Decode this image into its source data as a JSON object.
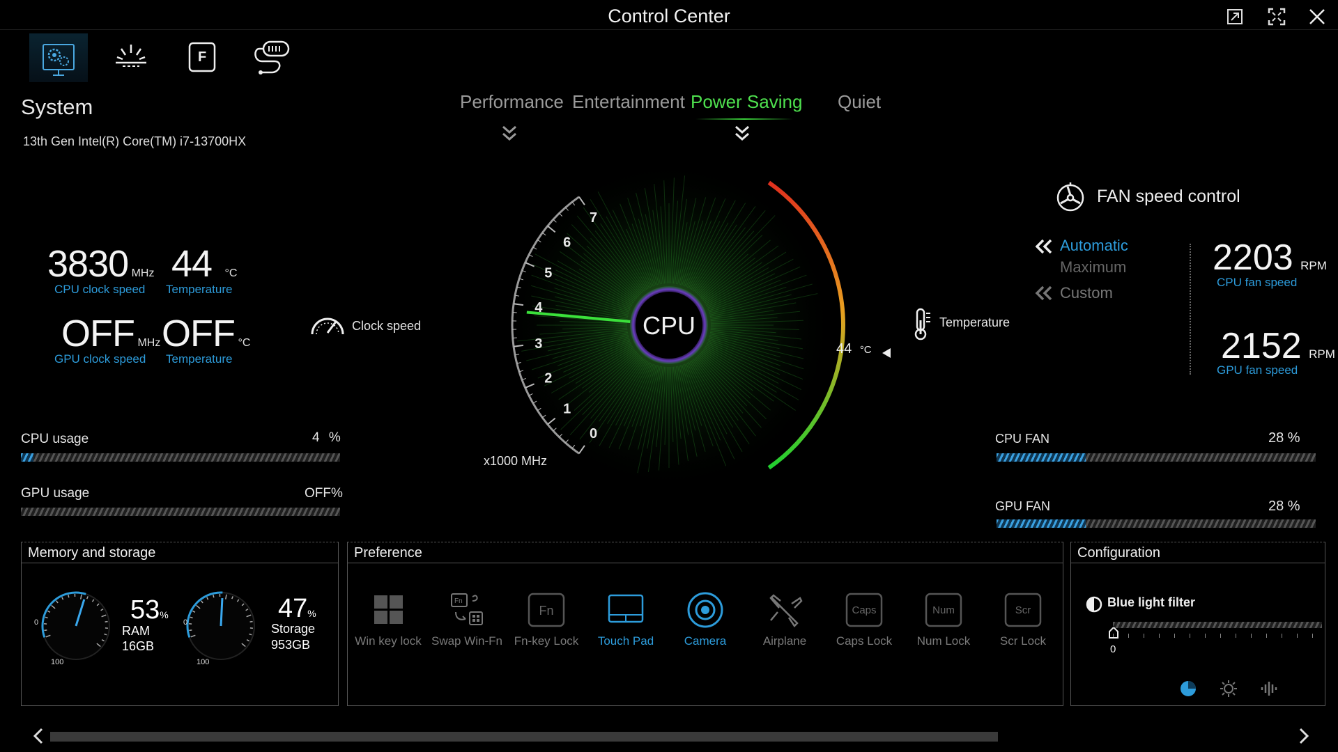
{
  "window": {
    "title": "Control Center"
  },
  "nav_tabs": [
    {
      "icon": "system-settings-icon",
      "active": true
    },
    {
      "icon": "lighting-icon",
      "active": false
    },
    {
      "icon": "function-key-icon",
      "active": false
    },
    {
      "icon": "usb-transfer-icon",
      "active": false
    }
  ],
  "system": {
    "title": "System",
    "cpu_model": "13th Gen Intel(R) Core(TM) i7-13700HX",
    "cpu_clock": {
      "value": "3830",
      "unit": "MHz",
      "caption": "CPU clock speed"
    },
    "cpu_temp": {
      "value": "44",
      "unit": "°C",
      "caption": "Temperature"
    },
    "gpu_clock": {
      "value": "OFF",
      "unit": "MHz",
      "caption": "GPU clock speed"
    },
    "gpu_temp": {
      "value": "OFF",
      "unit": "°C",
      "caption": "Temperature"
    },
    "cpu_usage": {
      "label": "CPU usage",
      "value": "4",
      "unit": "%",
      "level": 0.04
    },
    "gpu_usage": {
      "label": "GPU usage",
      "value": "OFF",
      "unit": "%",
      "level": 0
    }
  },
  "modes": {
    "items": [
      "Performance",
      "Entertainment",
      "Power Saving",
      "Quiet"
    ],
    "active": "Power Saving"
  },
  "gauge": {
    "center_label": "CPU",
    "clock_label": "Clock speed",
    "scale_unit": "x1000 MHz",
    "ticks": [
      "0",
      "1",
      "2",
      "3",
      "4",
      "5",
      "6",
      "7"
    ],
    "clock_value_ghz": 3.83,
    "temp_label": "Temperature",
    "temp_value": "44",
    "temp_unit": "°C"
  },
  "fan": {
    "title": "FAN speed control",
    "modes": [
      "Automatic",
      "Maximum",
      "Custom"
    ],
    "active_mode": "Automatic",
    "cpu_fan_speed": {
      "value": "2203",
      "unit": "RPM",
      "caption": "CPU fan speed"
    },
    "gpu_fan_speed": {
      "value": "2152",
      "unit": "RPM",
      "caption": "GPU fan speed"
    },
    "cpu_fan": {
      "label": "CPU FAN",
      "value": "28 %",
      "level": 0.28
    },
    "gpu_fan": {
      "label": "GPU FAN",
      "value": "28 %",
      "level": 0.28
    }
  },
  "memory": {
    "title": "Memory and storage",
    "ram": {
      "percent": "53",
      "unit": "%",
      "label": "RAM",
      "size": "16GB",
      "min": "0",
      "max": "100",
      "level": 0.53
    },
    "storage": {
      "percent": "47",
      "unit": "%",
      "label": "Storage",
      "size": "953GB",
      "min": "0",
      "max": "100",
      "level": 0.47
    }
  },
  "preference": {
    "title": "Preference",
    "items": [
      {
        "label": "Win key lock",
        "on": false
      },
      {
        "label": "Swap Win-Fn",
        "on": false
      },
      {
        "label": "Fn-key Lock",
        "on": false,
        "key": "Fn"
      },
      {
        "label": "Touch Pad",
        "on": true
      },
      {
        "label": "Camera",
        "on": true
      },
      {
        "label": "Airplane",
        "on": false
      },
      {
        "label": "Caps Lock",
        "on": false,
        "key": "Caps"
      },
      {
        "label": "Num Lock",
        "on": false,
        "key": "Num"
      },
      {
        "label": "Scr Lock",
        "on": false,
        "key": "Scr"
      }
    ]
  },
  "configuration": {
    "title": "Configuration",
    "blue_light": {
      "label": "Blue light filter",
      "value": "0"
    },
    "icons": [
      "display-mode-icon",
      "brightness-icon",
      "sound-wave-icon"
    ]
  },
  "colors": {
    "accent": "#2d9cdb",
    "mode_active": "#4ee04e",
    "background": "#000000"
  }
}
